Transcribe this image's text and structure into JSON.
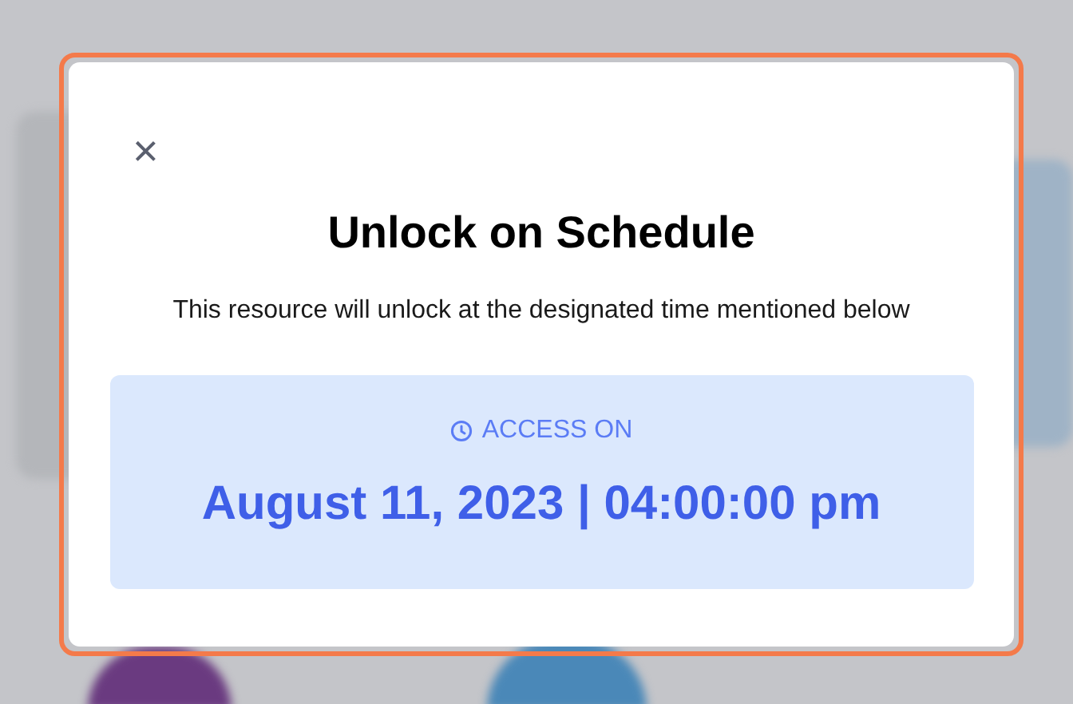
{
  "dialog": {
    "close": "×",
    "title": "Unlock on Schedule",
    "message": "This resource will unlock at the designated time mentioned below",
    "access": {
      "label": "ACCESS ON",
      "datetime": "August 11, 2023 | 04:00:00 pm"
    }
  }
}
